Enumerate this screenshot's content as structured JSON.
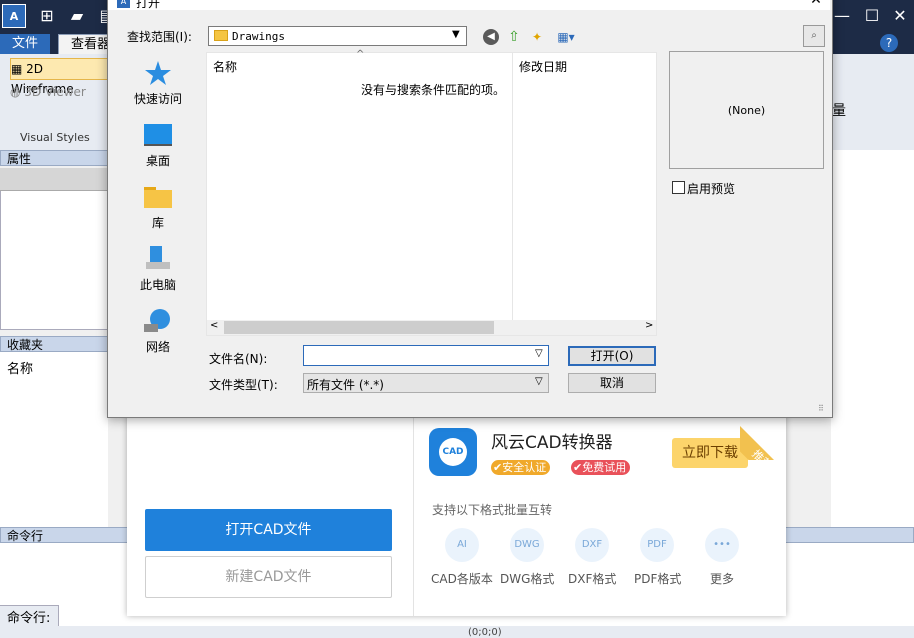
{
  "app": {
    "logo": "A",
    "menu": {
      "file": "文件",
      "view": "查看器"
    },
    "visual_styles": {
      "items": [
        "2D Wireframe",
        "3D Viewer"
      ],
      "group_label": "Visual Styles"
    },
    "panels": {
      "properties": "属性",
      "favorites": "收藏夹",
      "favorites_col": "名称",
      "command_line": "命令行",
      "command_prompt": "命令行:"
    },
    "ribbon_right_label": "量",
    "status_coords": "(0;0;0)",
    "help": "?"
  },
  "dialog": {
    "title": "打开",
    "look_in_label": "查找范围(I):",
    "look_in_value": "Drawings",
    "places": [
      {
        "label": "快速访问",
        "icon": "star-icon"
      },
      {
        "label": "桌面",
        "icon": "desktop-icon"
      },
      {
        "label": "库",
        "icon": "library-folder-icon"
      },
      {
        "label": "此电脑",
        "icon": "computer-icon"
      },
      {
        "label": "网络",
        "icon": "network-globe-icon"
      }
    ],
    "columns": {
      "name": "名称",
      "date": "修改日期"
    },
    "empty_message": "没有与搜索条件匹配的项。",
    "preview_none": "(None)",
    "preview_checkbox": "启用预览",
    "filename_label": "文件名(N):",
    "filename_value": "",
    "filetype_label": "文件类型(T):",
    "filetype_value": "所有文件 (*.*)",
    "open_button": "打开(O)",
    "cancel_button": "取消"
  },
  "promo": {
    "open_cad": "打开CAD文件",
    "new_cad": "新建CAD文件",
    "product_name": "风云CAD转换器",
    "logo_text": "CAD",
    "badge_safe": "安全认证",
    "badge_free": "免费试用",
    "download": "立即下载",
    "corner_tag": "推荐",
    "subtitle": "支持以下格式批量互转",
    "formats": [
      {
        "label": "CAD各版本",
        "icon": "AI"
      },
      {
        "label": "DWG格式",
        "icon": "DWG"
      },
      {
        "label": "DXF格式",
        "icon": "DXF"
      },
      {
        "label": "PDF格式",
        "icon": "PDF"
      },
      {
        "label": "更多",
        "icon": "•••"
      }
    ]
  }
}
